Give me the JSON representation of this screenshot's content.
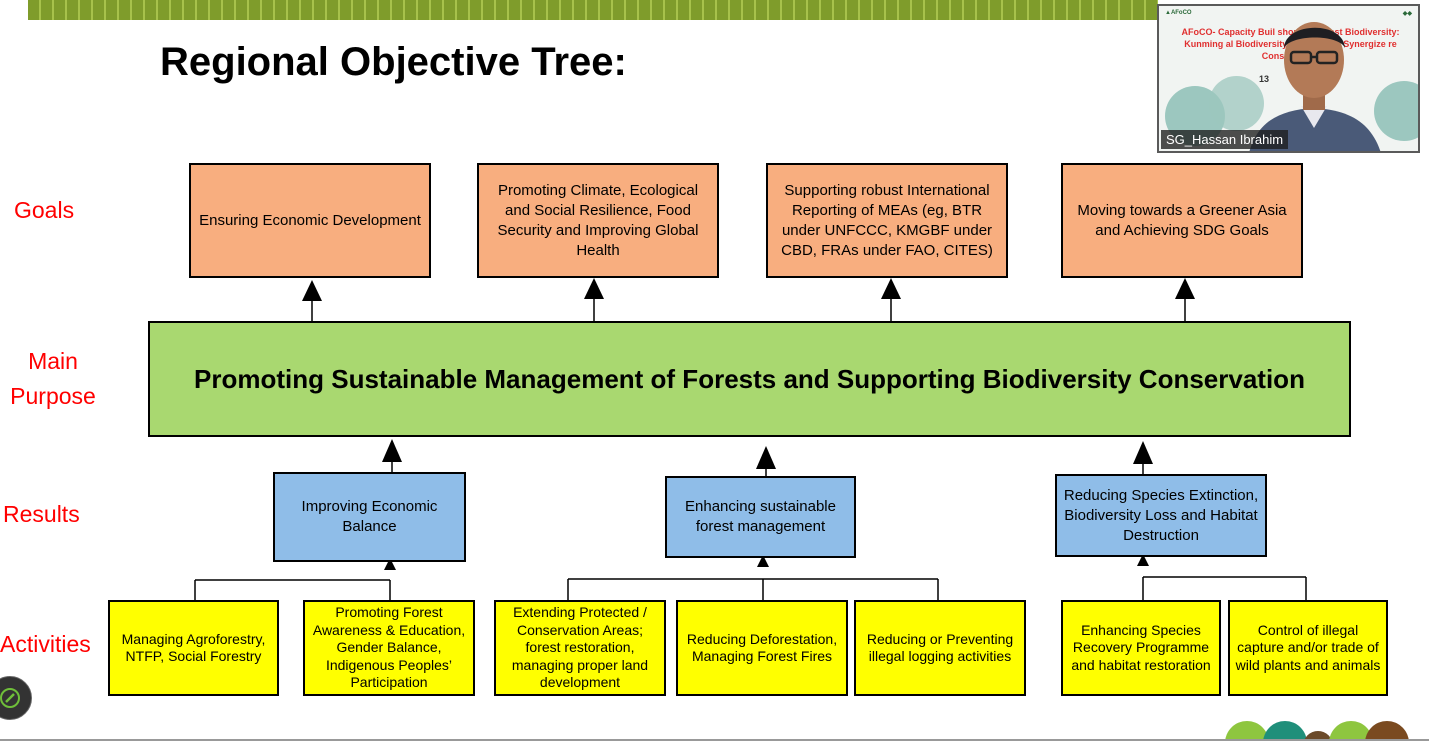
{
  "title": "Regional Objective Tree:",
  "row_labels": {
    "goals": "Goals",
    "main_line1": "Main",
    "main_line2": "Purpose",
    "results": "Results",
    "activities": "Activities"
  },
  "goals": [
    {
      "text": "Ensuring Economic Development"
    },
    {
      "text": "Promoting Climate, Ecological and Social Resilience, Food Security and Improving Global Health"
    },
    {
      "text": "Supporting robust International Reporting of MEAs (eg, BTR under UNFCCC, KMGBF under CBD, FRAs under FAO, CITES)"
    },
    {
      "text": "Moving towards a Greener Asia and Achieving SDG Goals"
    }
  ],
  "main_purpose": "Promoting Sustainable Management of Forests and Supporting Biodiversity Conservation",
  "results": [
    {
      "text": "Improving Economic Balance"
    },
    {
      "text": "Enhancing sustainable forest management"
    },
    {
      "text": "Reducing Species Extinction, Biodiversity Loss and Habitat Destruction"
    }
  ],
  "activities": [
    {
      "text": "Managing Agroforestry, NTFP, Social Forestry"
    },
    {
      "text": "Promoting Forest Awareness & Education, Gender Balance, Indigenous Peoples’ Participation"
    },
    {
      "text": "Extending Protected / Conservation Areas; forest restoration, managing proper  land development"
    },
    {
      "text": "Reducing Deforestation, Managing Forest Fires"
    },
    {
      "text": "Reducing or Preventing illegal logging activities"
    },
    {
      "text": "Enhancing Species Recovery Programme and habitat restoration"
    },
    {
      "text": "Control of illegal capture and/or trade of wild plants and animals"
    }
  ],
  "webcam": {
    "participant_name": "SG_Hassan Ibrahim",
    "slide_text": "AFoCO- Capacity Buil          shop on Forest Biodiversity: Kunming          al Biodiversity Framework: Synergize          re Conservation",
    "slide_number": "13"
  },
  "colors": {
    "goal_fill": "#f8ae7f",
    "main_fill": "#a9d870",
    "result_fill": "#8fbde8",
    "activity_fill": "#ffff00",
    "label_color": "#ff0000"
  }
}
